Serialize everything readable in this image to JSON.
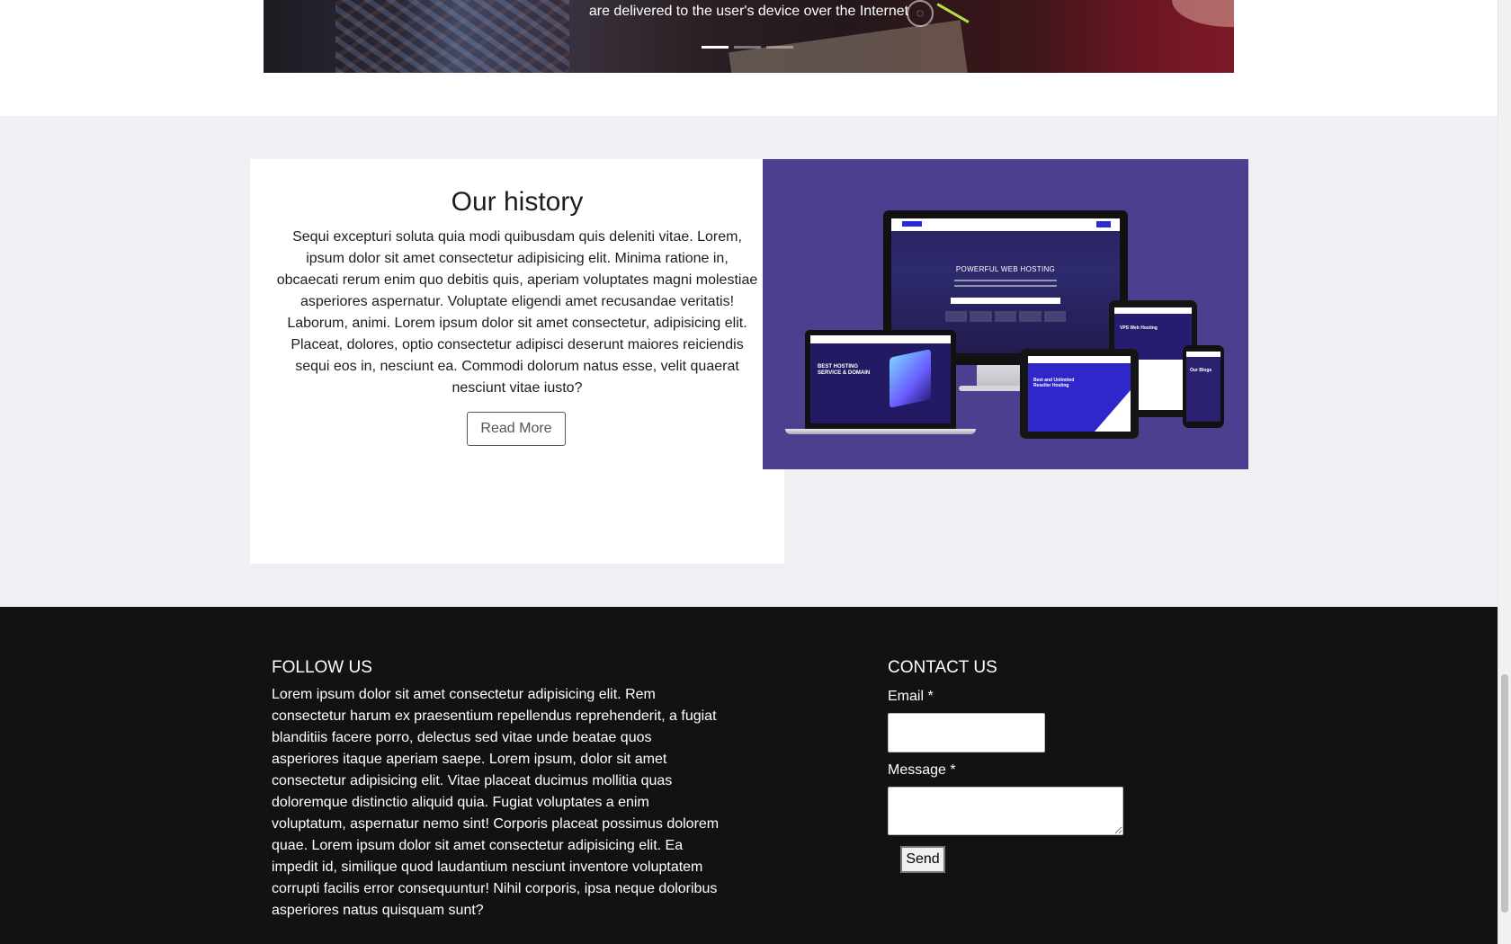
{
  "carousel": {
    "caption": "are delivered to the user's device over the Internet",
    "slides": [
      {
        "active": true
      },
      {
        "active": false
      },
      {
        "active": false
      }
    ]
  },
  "history": {
    "title": "Our history",
    "text": "Sequi excepturi soluta quia modi quibusdam quis deleniti vitae. Lorem, ipsum dolor sit amet consectetur adipisicing elit. Minima ratione in, obcaecati rerum enim quo debitis quis, aperiam voluptates magni molestiae asperiores aspernatur. Voluptate eligendi amet recusandae veritatis! Laborum, animi. Lorem ipsum dolor sit amet consectetur, adipisicing elit. Placeat, dolores, optio consectetur adipisci deserunt maiores reiciendis sequi eos in, nesciunt ea. Commodi dolorum natus esse, velit quaerat nesciunt vitae iusto?",
    "read_more_label": "Read More",
    "image": {
      "monitor_heading": "POWERFUL WEB HOSTING",
      "laptop_heading": "BEST HOSTING SERVICE & DOMAIN",
      "tablet_heading": "Best and Unlimited Reseller Hosting",
      "tablet2_heading": "VPS Web Hosting",
      "phone_heading": "Our Blogs"
    }
  },
  "footer": {
    "follow": {
      "heading": "FOLLOW US",
      "text": "Lorem ipsum dolor sit amet consectetur adipisicing elit. Rem consectetur harum ex praesentium repellendus reprehenderit, a fugiat blanditiis facere porro, delectus sed vitae unde beatae quos asperiores itaque aperiam saepe. Lorem ipsum, dolor sit amet consectetur adipisicing elit. Vitae placeat ducimus mollitia quas doloremque distinctio aliquid quia. Fugiat voluptates a enim voluptatum, aspernatur nemo sint! Corporis placeat possimus dolorem quae. Lorem ipsum dolor sit amet consectetur adipisicing elit. Ea impedit id, similique quod laudantium nesciunt inventore voluptatem corrupti facilis error consequuntur! Nihil corporis, ipsa neque doloribus asperiores natus quisquam sunt?"
    },
    "contact": {
      "heading": "CONTACT US",
      "email_label": "Email *",
      "email_value": "",
      "message_label": "Message *",
      "message_value": "",
      "send_label": "Send"
    }
  },
  "colors": {
    "section_bg": "#efeff4",
    "image_bg": "#4b3f8f",
    "footer_bg": "#121212"
  }
}
